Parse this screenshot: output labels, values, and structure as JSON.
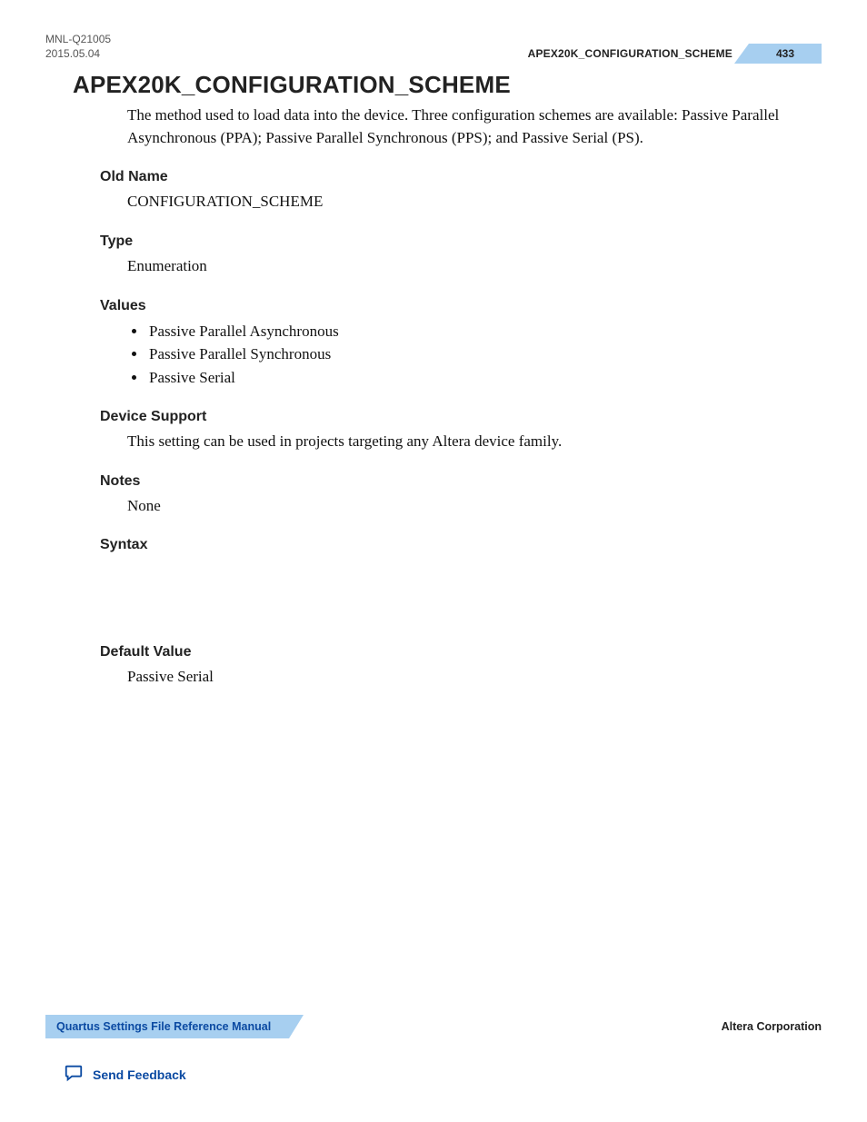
{
  "header": {
    "doc_id": "MNL-Q21005",
    "doc_date": "2015.05.04",
    "running_title": "APEX20K_CONFIGURATION_SCHEME",
    "page_number": "433"
  },
  "title": "APEX20K_CONFIGURATION_SCHEME",
  "intro": "The method used to load data into the device. Three configuration schemes are available: Passive Parallel Asynchronous (PPA); Passive Parallel Synchronous (PPS); and Passive Serial (PS).",
  "sections": {
    "old_name": {
      "heading": "Old Name",
      "value": "CONFIGURATION_SCHEME"
    },
    "type": {
      "heading": "Type",
      "value": "Enumeration"
    },
    "values": {
      "heading": "Values",
      "items": [
        "Passive Parallel Asynchronous",
        "Passive Parallel Synchronous",
        "Passive Serial"
      ]
    },
    "device_support": {
      "heading": "Device Support",
      "value": "This setting can be used in projects targeting any Altera device family."
    },
    "notes": {
      "heading": "Notes",
      "value": "None"
    },
    "syntax": {
      "heading": "Syntax",
      "value": ""
    },
    "default_value": {
      "heading": "Default Value",
      "value": "Passive Serial"
    }
  },
  "footer": {
    "manual_title": "Quartus Settings File Reference Manual",
    "company": "Altera Corporation",
    "feedback_label": "Send Feedback"
  }
}
